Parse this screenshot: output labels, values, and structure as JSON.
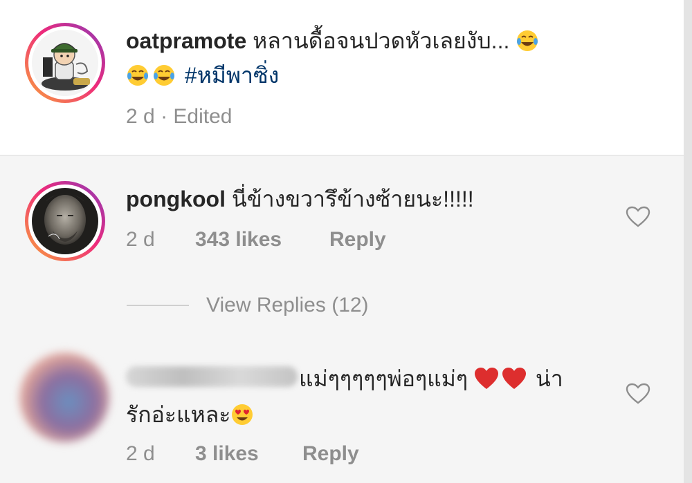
{
  "caption": {
    "username": "oatpramote",
    "text": "หลานดื้อจนปวดหัวเลยงับ...",
    "hashtag": "#หมีพาซิ่ง",
    "time": "2 d",
    "separator": "·",
    "edited": "Edited",
    "emojis": [
      "face-with-tears-of-joy",
      "face-with-tears-of-joy",
      "face-with-tears-of-joy"
    ]
  },
  "comments": [
    {
      "username": "pongkool",
      "text": "นี่ข้างขวารึข้างซ้ายนะ!!!!!",
      "time": "2 d",
      "likes": "343 likes",
      "reply": "Reply",
      "view_replies": "View Replies (12)"
    },
    {
      "username": "",
      "text_line1": "แม่ๆๆๆๆๆพ่อๆแม่ๆ",
      "text_line1_end": "น่า",
      "text_line2": "รักอ่ะแหละ",
      "time": "2 d",
      "likes": "3 likes",
      "reply": "Reply",
      "emojis": [
        "red-heart",
        "red-heart",
        "smiling-face-with-heart-eyes"
      ]
    }
  ],
  "colors": {
    "text": "#262626",
    "muted": "#8e8e8e",
    "hashtag": "#003569",
    "ring_start": "#f9a63a",
    "ring_end": "#8a3ab9",
    "heart_red": "#e0242f"
  }
}
